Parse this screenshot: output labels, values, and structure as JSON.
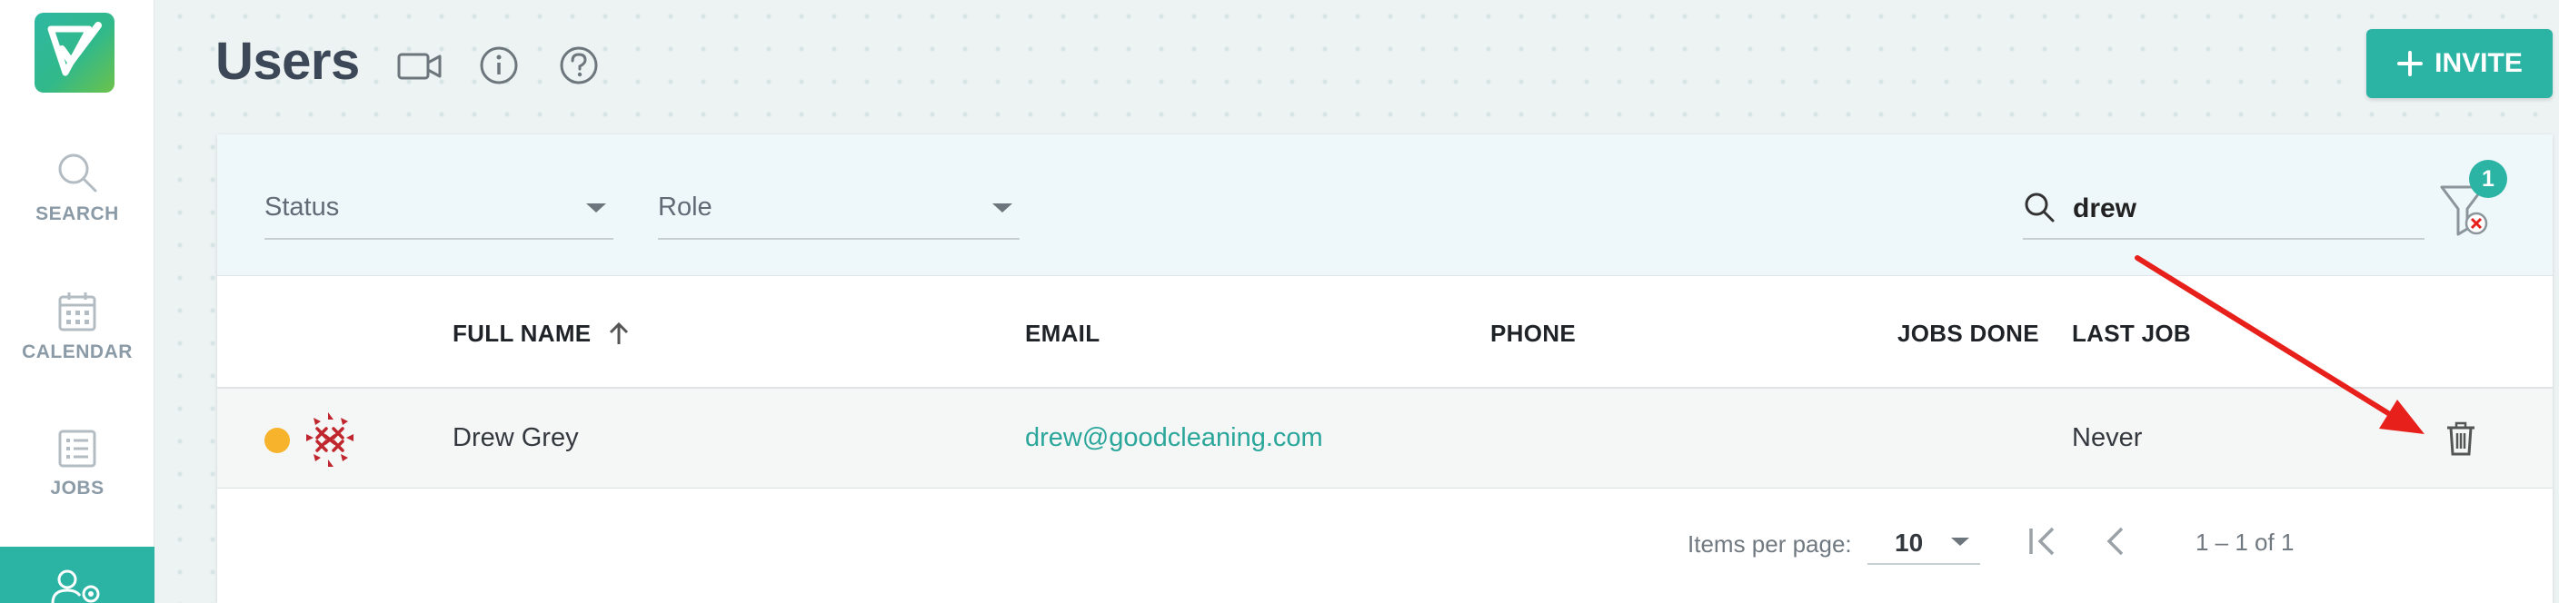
{
  "sidebar": {
    "logo_icon": "checkmark-logo",
    "items": [
      {
        "label": "SEARCH",
        "icon": "search-icon"
      },
      {
        "label": "CALENDAR",
        "icon": "calendar-icon"
      },
      {
        "label": "JOBS",
        "icon": "list-icon"
      },
      {
        "label": "",
        "icon": "users-settings-icon",
        "active": true
      }
    ]
  },
  "header": {
    "title": "Users",
    "icons": [
      "video-icon",
      "info-icon",
      "help-icon"
    ],
    "invite_label": "INVITE"
  },
  "filters": {
    "status_label": "Status",
    "role_label": "Role",
    "search_value": "drew",
    "active_filter_count": "1"
  },
  "table": {
    "columns": [
      "FULL NAME",
      "EMAIL",
      "PHONE",
      "JOBS DONE",
      "LAST JOB"
    ],
    "sort_column": "FULL NAME",
    "sort_direction": "ascending",
    "rows": [
      {
        "status_color": "#f7b32b",
        "full_name": "Drew Grey",
        "email": "drew@goodcleaning.com",
        "phone": "",
        "jobs_done": "",
        "last_job": "Never"
      }
    ]
  },
  "paginator": {
    "items_per_page_label": "Items per page:",
    "page_size": "10",
    "range_label": "1 – 1 of 1"
  },
  "colors": {
    "accent": "#2bb3a4",
    "status_pending": "#f7b32b",
    "annotation_arrow": "#e8201b"
  }
}
